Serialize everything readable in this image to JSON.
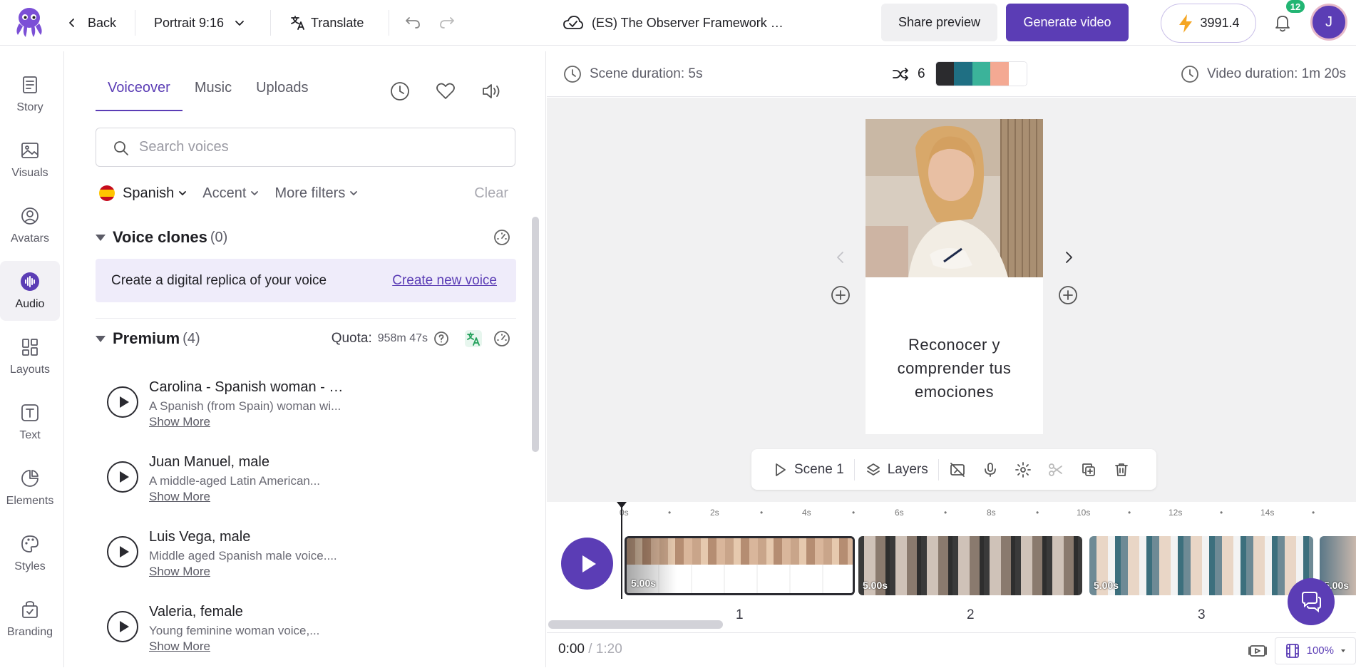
{
  "topbar": {
    "back_label": "Back",
    "aspect_label": "Portrait 9:16",
    "translate_label": "Translate",
    "project_title": "(ES) The Observer Framework …",
    "share_label": "Share preview",
    "generate_label": "Generate video",
    "credits": "3991.4",
    "notification_count": "12",
    "avatar_initial": "J"
  },
  "rail": {
    "items": [
      {
        "label": "Story",
        "icon": "story-icon"
      },
      {
        "label": "Visuals",
        "icon": "image-icon"
      },
      {
        "label": "Avatars",
        "icon": "avatar-icon"
      },
      {
        "label": "Audio",
        "icon": "audio-icon",
        "active": true
      },
      {
        "label": "Layouts",
        "icon": "layouts-icon"
      },
      {
        "label": "Text",
        "icon": "text-icon"
      },
      {
        "label": "Elements",
        "icon": "elements-icon"
      },
      {
        "label": "Styles",
        "icon": "palette-icon"
      },
      {
        "label": "Branding",
        "icon": "branding-icon"
      }
    ]
  },
  "panel": {
    "tabs": [
      {
        "label": "Voiceover",
        "active": true
      },
      {
        "label": "Music"
      },
      {
        "label": "Uploads"
      }
    ],
    "search_placeholder": "Search voices",
    "filters": {
      "language": "Spanish",
      "accent": "Accent",
      "more": "More filters",
      "clear": "Clear"
    },
    "voice_clones": {
      "title": "Voice clones",
      "count": "(0)",
      "prompt": "Create a digital replica of your voice",
      "link": "Create new voice"
    },
    "premium": {
      "title": "Premium",
      "count": "(4)",
      "quota_label": "Quota:",
      "quota_value": "958m 47s"
    },
    "voices": [
      {
        "name": "Carolina - Spanish woman - …",
        "desc": "A Spanish (from Spain) woman wi...",
        "more": "Show More"
      },
      {
        "name": "Juan Manuel, male",
        "desc": "A middle-aged Latin American...",
        "more": "Show More"
      },
      {
        "name": "Luis Vega, male",
        "desc": "Middle aged Spanish male voice....",
        "more": "Show More"
      },
      {
        "name": "Valeria, female",
        "desc": "Young feminine woman voice,...",
        "more": "Show More"
      }
    ]
  },
  "editor": {
    "scene_duration": "Scene duration: 5s",
    "shuffle_count": "6",
    "palette": [
      "#2b2b2e",
      "#1f6f83",
      "#3bb39a",
      "#f4a993",
      "#ffffff"
    ],
    "video_duration": "Video duration: 1m 20s",
    "card_text": "Reconocer y comprender tus emociones",
    "scene_label": "Scene 1",
    "layers_label": "Layers"
  },
  "timeline": {
    "ticks": [
      "0s",
      "2s",
      "4s",
      "6s",
      "8s",
      "10s",
      "12s",
      "14s"
    ],
    "clips": [
      {
        "duration": "5.00s",
        "number": "1"
      },
      {
        "duration": "5.00s",
        "number": "2"
      },
      {
        "duration": "5.00s",
        "number": "3"
      },
      {
        "duration": "5.00s",
        "number": ""
      }
    ],
    "current_time": "0:00",
    "total_time": "/ 1:20",
    "zoom": "100%"
  }
}
